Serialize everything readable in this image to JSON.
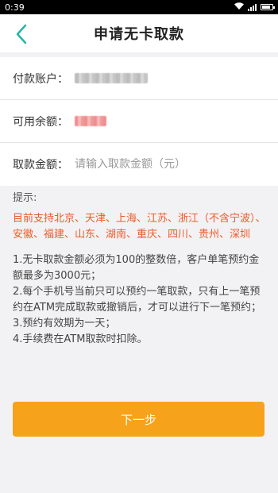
{
  "status_bar": {
    "time": "0:39"
  },
  "header": {
    "title": "申请无卡取款"
  },
  "form": {
    "account_label": "付款账户：",
    "balance_label": "可用余额：",
    "amount_label": "取款金额：",
    "amount_placeholder": "请输入取款金额（元）"
  },
  "tips": {
    "title": "提示:",
    "cities": "目前支持北京、天津、上海、江苏、浙江（不含宁波）、安徽、福建、山东、湖南、重庆、四川、贵州、深圳",
    "rules": [
      "1.无卡取款金额必须为100的整数倍，客户单笔预约金额最多为3000元；",
      "2.每个手机号当前只可以预约一笔取款，只有上一笔预约在ATM完成取款或撤销后，才可以进行下一笔预约；",
      "3.预约有效期为一天；",
      "4.手续费在ATM取款时扣除。"
    ]
  },
  "actions": {
    "next_label": "下一步"
  },
  "colors": {
    "accent": "#f7a21b",
    "highlight": "#f05a28",
    "back_arrow": "#26b4a5"
  },
  "icons": {
    "back": "chevron-left-icon",
    "wifi": "wifi-icon",
    "signal": "signal-icon",
    "battery": "battery-icon"
  }
}
